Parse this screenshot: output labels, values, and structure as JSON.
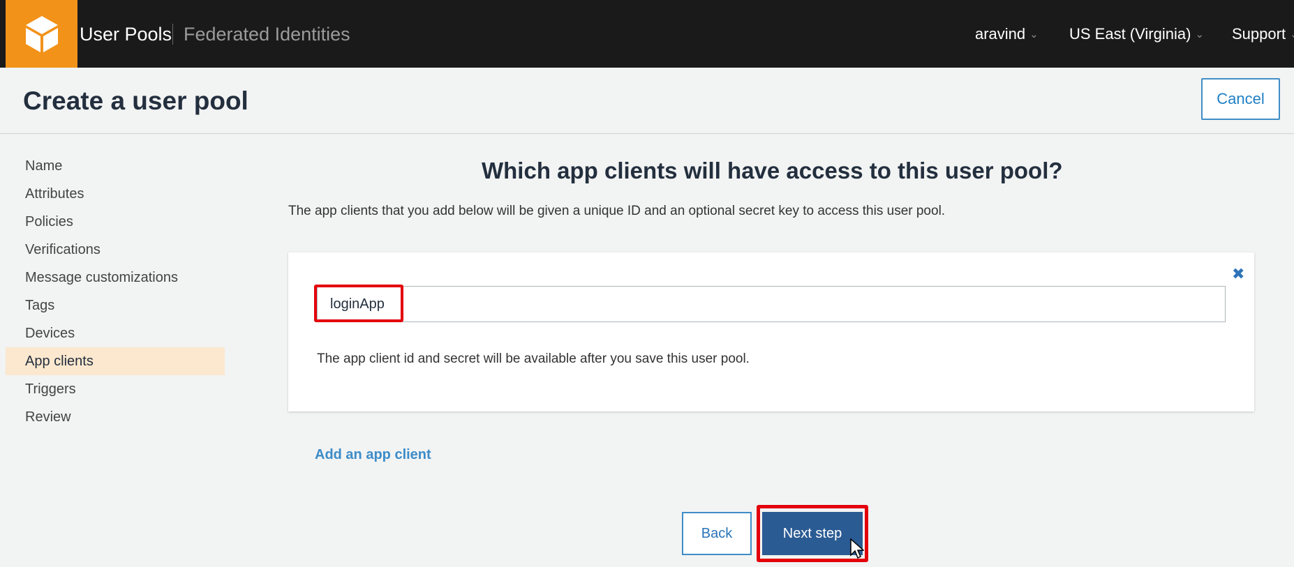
{
  "topbar": {
    "nav_user_pools": "User Pools",
    "nav_federated": "Federated Identities",
    "account": "aravind",
    "region": "US East (Virginia)",
    "support": "Support",
    "chevron": "⌄",
    "logo_icon": "cube-icon",
    "colors": {
      "bar": "#1a1a1a",
      "logo": "#f29219"
    }
  },
  "header": {
    "title": "Create a user pool",
    "cancel_label": "Cancel"
  },
  "sidebar": {
    "items": [
      {
        "label": "Name"
      },
      {
        "label": "Attributes"
      },
      {
        "label": "Policies"
      },
      {
        "label": "Verifications"
      },
      {
        "label": "Message customizations"
      },
      {
        "label": "Tags"
      },
      {
        "label": "Devices"
      },
      {
        "label": "App clients",
        "active": true
      },
      {
        "label": "Triggers"
      },
      {
        "label": "Review"
      }
    ]
  },
  "main": {
    "question": "Which app clients will have access to this user pool?",
    "description": "The app clients that you add below will be given a unique ID and an optional secret key to access this user pool.",
    "app_client": {
      "name_value": "loginApp",
      "note": "The app client id and secret will be available after you save this user pool.",
      "remove_icon": "close-icon",
      "remove_glyph": "✖"
    },
    "add_link": "Add an app client",
    "back_label": "Back",
    "next_label": "Next step"
  },
  "annotations": {
    "highlight_color": "#e3000b"
  }
}
